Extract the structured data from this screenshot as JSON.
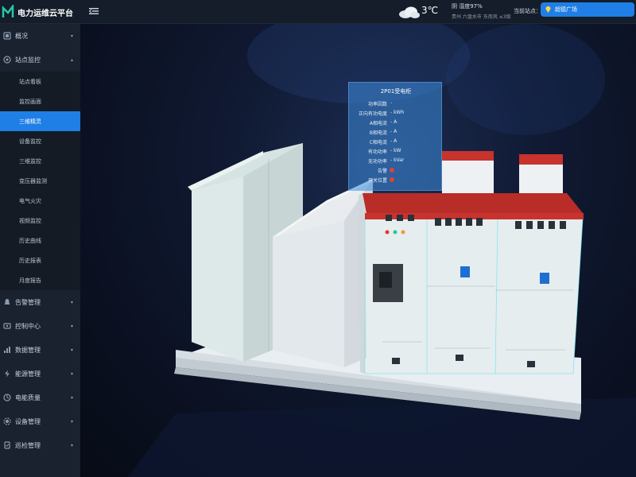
{
  "app": {
    "title": "电力运维云平台"
  },
  "header": {
    "weather": {
      "temp": "3℃",
      "condition": "阴 湿度97%",
      "location": "贵州 六盘水市 东南风 ≤3级",
      "icon": "cloud-icon"
    },
    "site_label": "当前站点：",
    "site_value": "超德广场"
  },
  "sidebar": {
    "groups_top": [
      {
        "label": "概况",
        "icon": "overview-icon",
        "chevron": "▾"
      },
      {
        "label": "站点监控",
        "icon": "monitor-icon",
        "chevron": "▴"
      }
    ],
    "sub_items": [
      {
        "label": "站点看板",
        "active": false
      },
      {
        "label": "监控画面",
        "active": false
      },
      {
        "label": "三维精灵",
        "active": true
      },
      {
        "label": "设备监控",
        "active": false
      },
      {
        "label": "三维监控",
        "active": false
      },
      {
        "label": "变压器监测",
        "active": false
      },
      {
        "label": "电气火灾",
        "active": false
      },
      {
        "label": "视频监控",
        "active": false
      },
      {
        "label": "历史曲线",
        "active": false
      },
      {
        "label": "历史报表",
        "active": false
      },
      {
        "label": "月度报告",
        "active": false
      }
    ],
    "groups_bottom": [
      {
        "label": "告警管理",
        "icon": "alarm-icon",
        "chevron": "▾"
      },
      {
        "label": "控制中心",
        "icon": "control-icon",
        "chevron": "▾"
      },
      {
        "label": "数据管理",
        "icon": "data-icon",
        "chevron": "▾"
      },
      {
        "label": "能源管理",
        "icon": "energy-icon",
        "chevron": "▾"
      },
      {
        "label": "电能质量",
        "icon": "quality-icon",
        "chevron": "▾"
      },
      {
        "label": "设备管理",
        "icon": "device-icon",
        "chevron": "▾"
      },
      {
        "label": "巡检管理",
        "icon": "inspect-icon",
        "chevron": "▾"
      }
    ]
  },
  "info_panel": {
    "title": "2P01受电柜",
    "rows": [
      {
        "label": "功率因数",
        "value": "-"
      },
      {
        "label": "正向有功电度",
        "value": "- kWh"
      },
      {
        "label": "A相电流",
        "value": "- A"
      },
      {
        "label": "B相电流",
        "value": "- A"
      },
      {
        "label": "C相电流",
        "value": "- A"
      },
      {
        "label": "有功功率",
        "value": "- kW"
      },
      {
        "label": "无功功率",
        "value": "- kVar"
      }
    ],
    "status": [
      {
        "label": "告警",
        "state": "red"
      },
      {
        "label": "开关位置",
        "state": "red"
      }
    ]
  },
  "colors": {
    "accent": "#1f7fe6",
    "sidebar_bg": "#19222e",
    "cabinet_red": "#c8332e",
    "status_red": "#e0403a"
  }
}
